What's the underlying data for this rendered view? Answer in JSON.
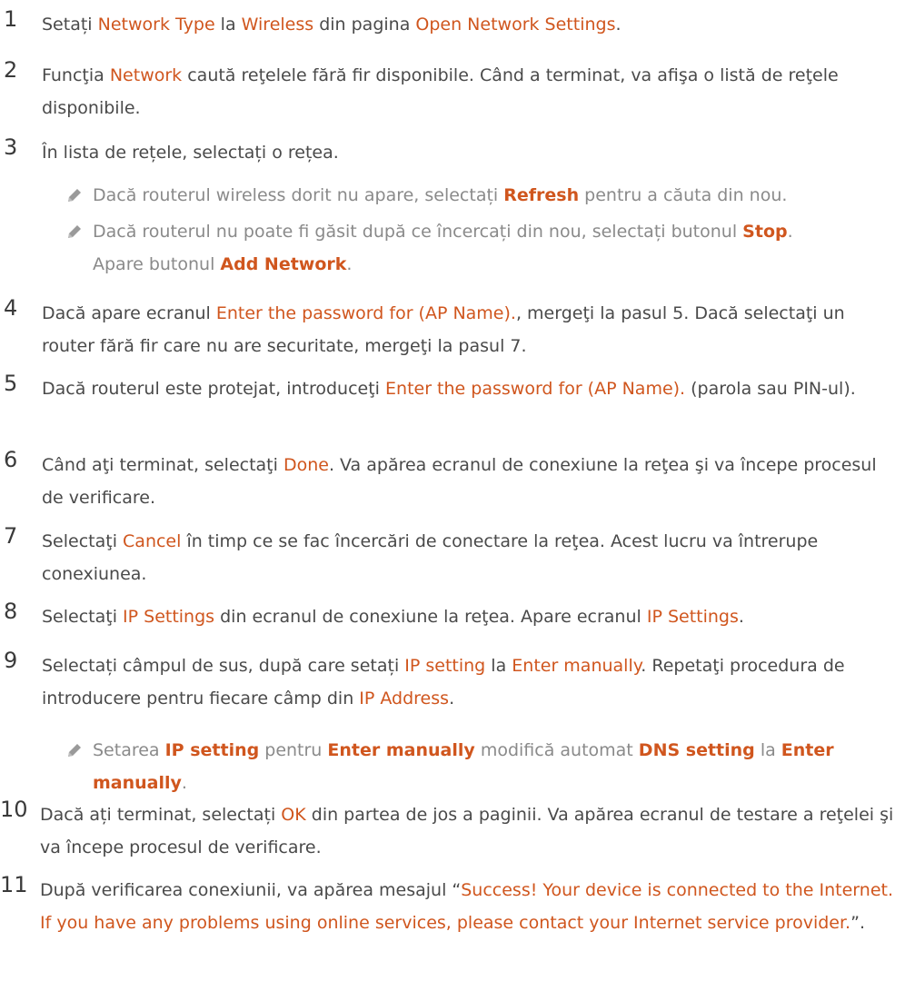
{
  "colors": {
    "text": "#4a4a4a",
    "note": "#8a8a8a",
    "accent": "#d0561e"
  },
  "steps": [
    {
      "num": "1",
      "parts": [
        "Setați ",
        "Network Type",
        " la ",
        "Wireless",
        " din pagina ",
        "Open Network Settings",
        "."
      ]
    },
    {
      "num": "2",
      "parts": [
        "Funcţia ",
        "Network",
        " caută reţelele fără fir disponibile. Când a terminat, va afişa o listă de reţele disponibile."
      ]
    },
    {
      "num": "3",
      "parts": [
        "În lista de rețele, selectați o rețea."
      ],
      "notes": [
        {
          "icon": "pencil-note-icon",
          "parts": [
            "Dacă routerul wireless dorit nu apare, selectați ",
            "Refresh",
            " pentru a căuta din nou."
          ]
        },
        {
          "icon": "pencil-note-icon",
          "parts": [
            "Dacă routerul nu poate fi găsit după ce încercați din nou, selectați butonul ",
            "Stop",
            ".",
            "Apare butonul ",
            "Add Network",
            "."
          ]
        }
      ]
    },
    {
      "num": "4",
      "parts": [
        "Dacă apare ecranul ",
        "Enter the password for (AP Name).",
        ", mergeţi la pasul 5. Dacă selectaţi un router fără fir care nu are securitate, mergeţi la pasul 7."
      ]
    },
    {
      "num": "5",
      "parts": [
        "Dacă routerul este protejat, introduceţi ",
        "Enter the password for (AP Name).",
        " (parola sau PIN-ul)."
      ]
    },
    {
      "num": "6",
      "parts": [
        "Când aţi terminat, selectaţi ",
        "Done",
        ". Va apărea ecranul de conexiune la reţea şi va începe procesul de verificare."
      ]
    },
    {
      "num": "7",
      "parts": [
        "Selectaţi ",
        "Cancel",
        " în timp ce se fac încercări de conectare la reţea. Acest lucru va întrerupe conexiunea."
      ]
    },
    {
      "num": "8",
      "parts": [
        "Selectaţi ",
        "IP Settings",
        " din ecranul de conexiune la reţea. Apare ecranul ",
        "IP Settings",
        "."
      ]
    },
    {
      "num": "9",
      "parts": [
        "Selectați câmpul de sus, după care setați ",
        "IP setting",
        " la ",
        "Enter manually",
        ". Repetaţi procedura de introducere pentru fiecare câmp din ",
        "IP Address",
        "."
      ],
      "notes": [
        {
          "icon": "pencil-note-icon",
          "parts": [
            "Setarea ",
            "IP setting",
            " pentru ",
            "Enter manually",
            " modifică automat ",
            "DNS setting",
            " la ",
            "Enter manually",
            "."
          ]
        }
      ]
    },
    {
      "num": "10",
      "parts": [
        "Dacă ați terminat, selectați ",
        "OK",
        " din partea de jos a paginii. Va apărea ecranul de testare a reţelei şi va începe procesul de verificare."
      ]
    },
    {
      "num": "11",
      "parts": [
        "După verificarea conexiunii, va apărea mesajul “",
        "Success! Your device is connected to the Internet. If you have any problems using online services, please contact your Internet service provider.",
        "”."
      ]
    }
  ]
}
